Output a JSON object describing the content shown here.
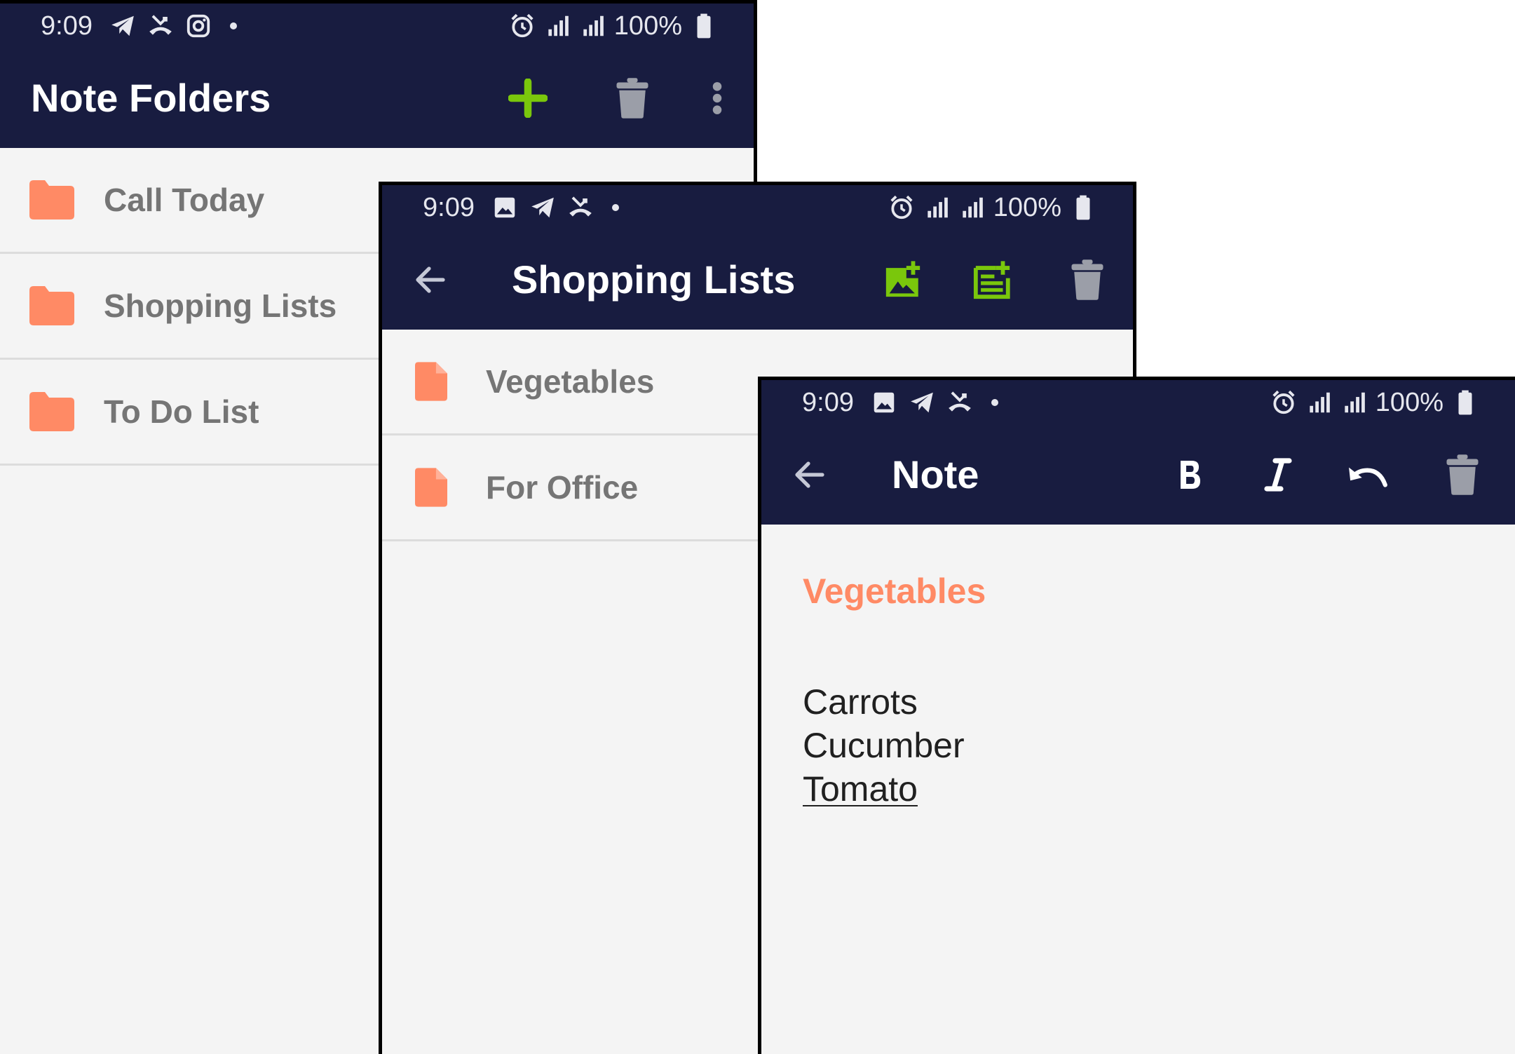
{
  "colors": {
    "bar_background": "#181c40",
    "accent_green": "#7ac70c",
    "folder_orange": "#ff8a65",
    "list_text_gray": "#757575"
  },
  "screen_folders": {
    "status": {
      "time": "9:09",
      "battery": "100%",
      "icons_left": [
        "telegram-icon",
        "missed-call-icon",
        "instagram-icon",
        "dot"
      ],
      "icons_right": [
        "alarm-icon",
        "signal-icon",
        "signal-icon",
        "battery-icon"
      ]
    },
    "title": "Note Folders",
    "actions": [
      "add-icon",
      "trash-icon",
      "more-vert-icon"
    ],
    "folders": [
      {
        "label": "Call Today"
      },
      {
        "label": "Shopping Lists"
      },
      {
        "label": "To Do List"
      }
    ]
  },
  "screen_shopping": {
    "status": {
      "time": "9:09",
      "battery": "100%",
      "icons_left": [
        "image-icon",
        "telegram-icon",
        "missed-call-icon",
        "dot"
      ],
      "icons_right": [
        "alarm-icon",
        "signal-icon",
        "signal-icon",
        "battery-icon"
      ]
    },
    "title": "Shopping Lists",
    "actions": [
      "add-image-note-icon",
      "add-text-note-icon",
      "trash-icon"
    ],
    "notes": [
      {
        "label": "Vegetables"
      },
      {
        "label": "For Office"
      }
    ]
  },
  "screen_note": {
    "status": {
      "time": "9:09",
      "battery": "100%",
      "icons_left": [
        "image-icon",
        "telegram-icon",
        "missed-call-icon",
        "dot"
      ],
      "icons_right": [
        "alarm-icon",
        "signal-icon",
        "signal-icon",
        "battery-icon"
      ]
    },
    "title": "Note",
    "actions": [
      "bold-icon",
      "italic-icon",
      "undo-icon",
      "trash-icon"
    ],
    "note_title": "Vegetables",
    "lines": [
      "Carrots",
      "Cucumber",
      "Tomato"
    ]
  }
}
